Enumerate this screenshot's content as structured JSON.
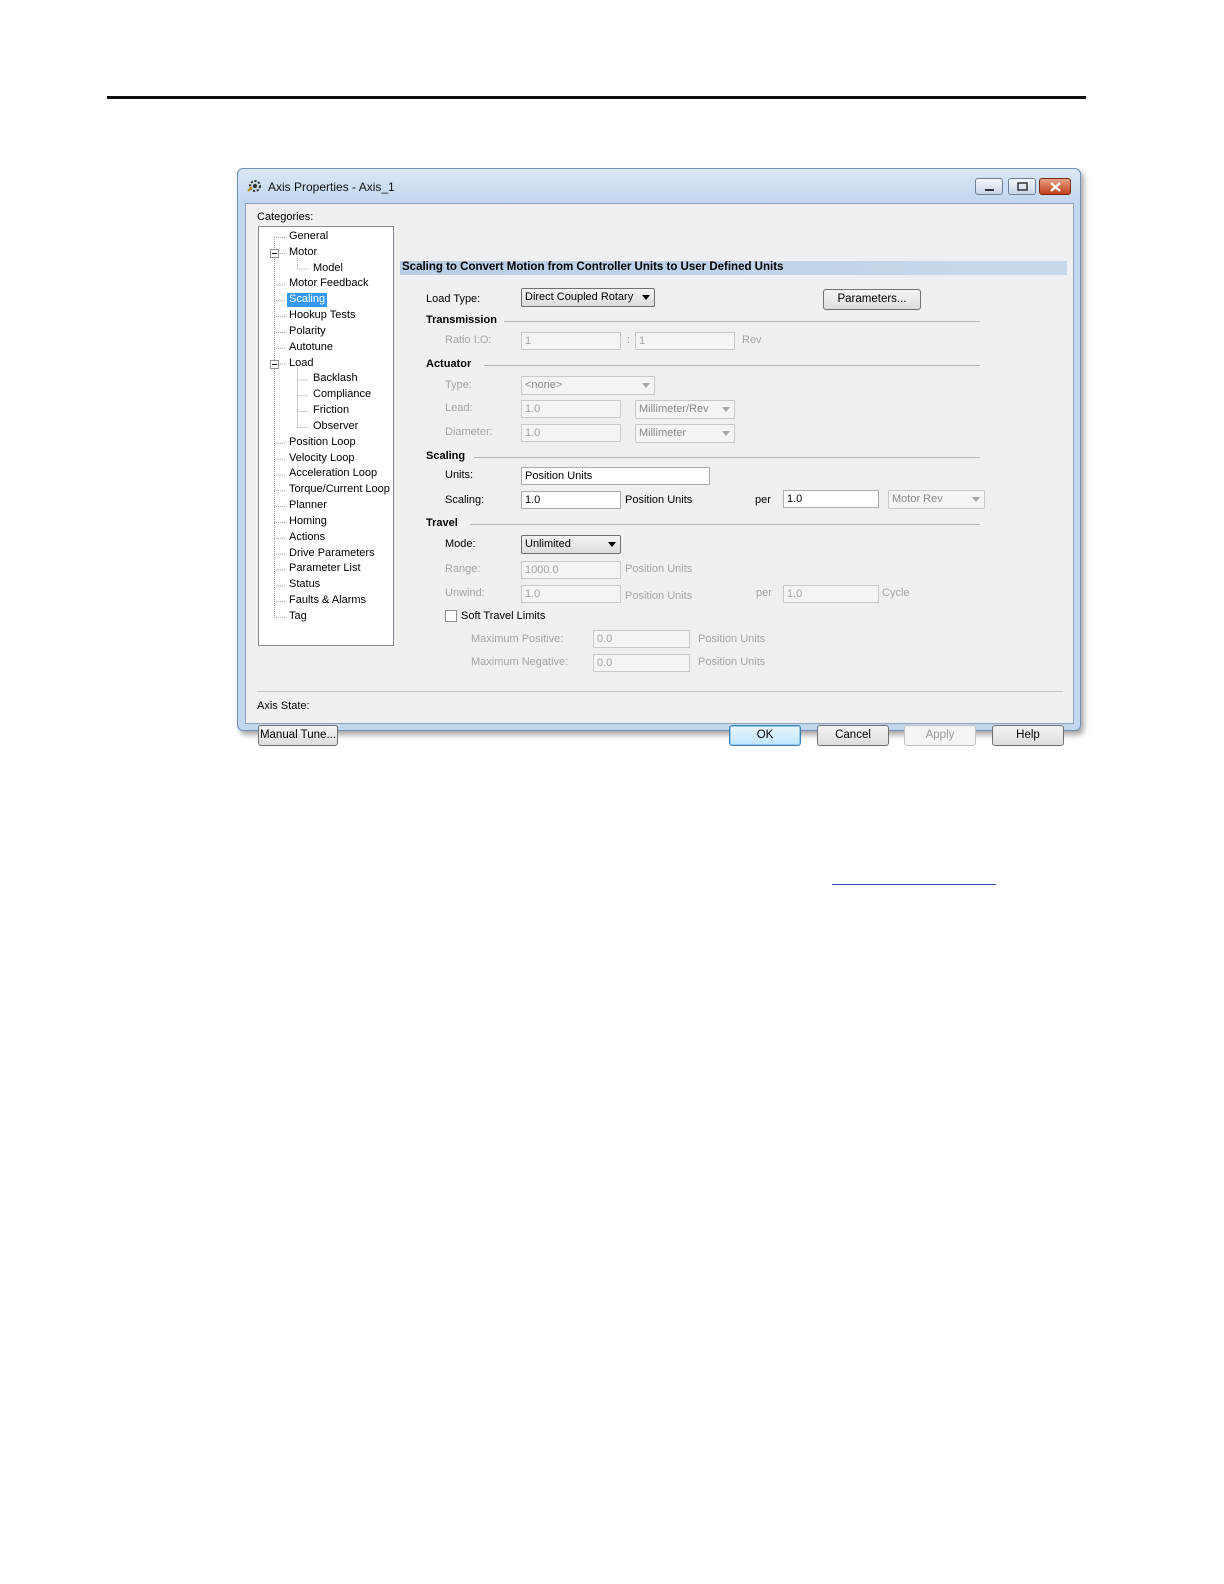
{
  "window": {
    "title": "Axis Properties - Axis_1"
  },
  "categories_label": "Categories:",
  "tree": [
    {
      "label": "General",
      "level": 1
    },
    {
      "label": "Motor",
      "level": 1,
      "expander": "minus"
    },
    {
      "label": "Model",
      "level": 2
    },
    {
      "label": "Motor Feedback",
      "level": 1
    },
    {
      "label": "Scaling",
      "level": 1,
      "selected": true
    },
    {
      "label": "Hookup Tests",
      "level": 1
    },
    {
      "label": "Polarity",
      "level": 1
    },
    {
      "label": "Autotune",
      "level": 1
    },
    {
      "label": "Load",
      "level": 1,
      "expander": "minus"
    },
    {
      "label": "Backlash",
      "level": 2
    },
    {
      "label": "Compliance",
      "level": 2
    },
    {
      "label": "Friction",
      "level": 2
    },
    {
      "label": "Observer",
      "level": 2
    },
    {
      "label": "Position Loop",
      "level": 1
    },
    {
      "label": "Velocity Loop",
      "level": 1
    },
    {
      "label": "Acceleration Loop",
      "level": 1
    },
    {
      "label": "Torque/Current Loop",
      "level": 1
    },
    {
      "label": "Planner",
      "level": 1
    },
    {
      "label": "Homing",
      "level": 1
    },
    {
      "label": "Actions",
      "level": 1
    },
    {
      "label": "Drive Parameters",
      "level": 1
    },
    {
      "label": "Parameter List",
      "level": 1
    },
    {
      "label": "Status",
      "level": 1
    },
    {
      "label": "Faults & Alarms",
      "level": 1
    },
    {
      "label": "Tag",
      "level": 1
    }
  ],
  "header": "Scaling to Convert Motion from Controller Units to User Defined Units",
  "load_type": {
    "label": "Load Type:",
    "value": "Direct Coupled Rotary"
  },
  "parameters_button": "Parameters...",
  "transmission": {
    "section": "Transmission",
    "ratio_label": "Ratio I:O:",
    "ratio_in": "1",
    "colon": ":",
    "ratio_out": "1",
    "unit": "Rev"
  },
  "actuator": {
    "section": "Actuator",
    "type_label": "Type:",
    "type_value": "<none>",
    "lead_label": "Lead:",
    "lead_value": "1.0",
    "lead_unit": "Millimeter/Rev",
    "diameter_label": "Diameter:",
    "diameter_value": "1.0",
    "diameter_unit": "Millimeter"
  },
  "scaling": {
    "section": "Scaling",
    "units_label": "Units:",
    "units_value": "Position Units",
    "scaling_label": "Scaling:",
    "scaling_value": "1.0",
    "scaling_units": "Position Units",
    "per": "per",
    "per_value": "1.0",
    "per_unit": "Motor Rev"
  },
  "travel": {
    "section": "Travel",
    "mode_label": "Mode:",
    "mode_value": "Unlimited",
    "range_label": "Range:",
    "range_value": "1000.0",
    "range_units": "Position Units",
    "unwind_label": "Unwind:",
    "unwind_value": "1.0",
    "unwind_units": "Position Units",
    "per": "per",
    "cycle_value": "1.0",
    "cycle_label": "Cycle",
    "soft_limits_label": "Soft Travel Limits",
    "soft_limits_checked": false,
    "max_pos_label": "Maximum Positive:",
    "max_pos_value": "0.0",
    "max_pos_units": "Position Units",
    "max_neg_label": "Maximum Negative:",
    "max_neg_value": "0.0",
    "max_neg_units": "Position Units"
  },
  "axis_state_label": "Axis State:",
  "buttons": {
    "manual_tune": "Manual Tune...",
    "ok": "OK",
    "cancel": "Cancel",
    "apply": "Apply",
    "help": "Help"
  },
  "colors": {
    "selection": "#3399ff",
    "header_bar": "#b9cde6",
    "close_button": "#c2401b"
  }
}
